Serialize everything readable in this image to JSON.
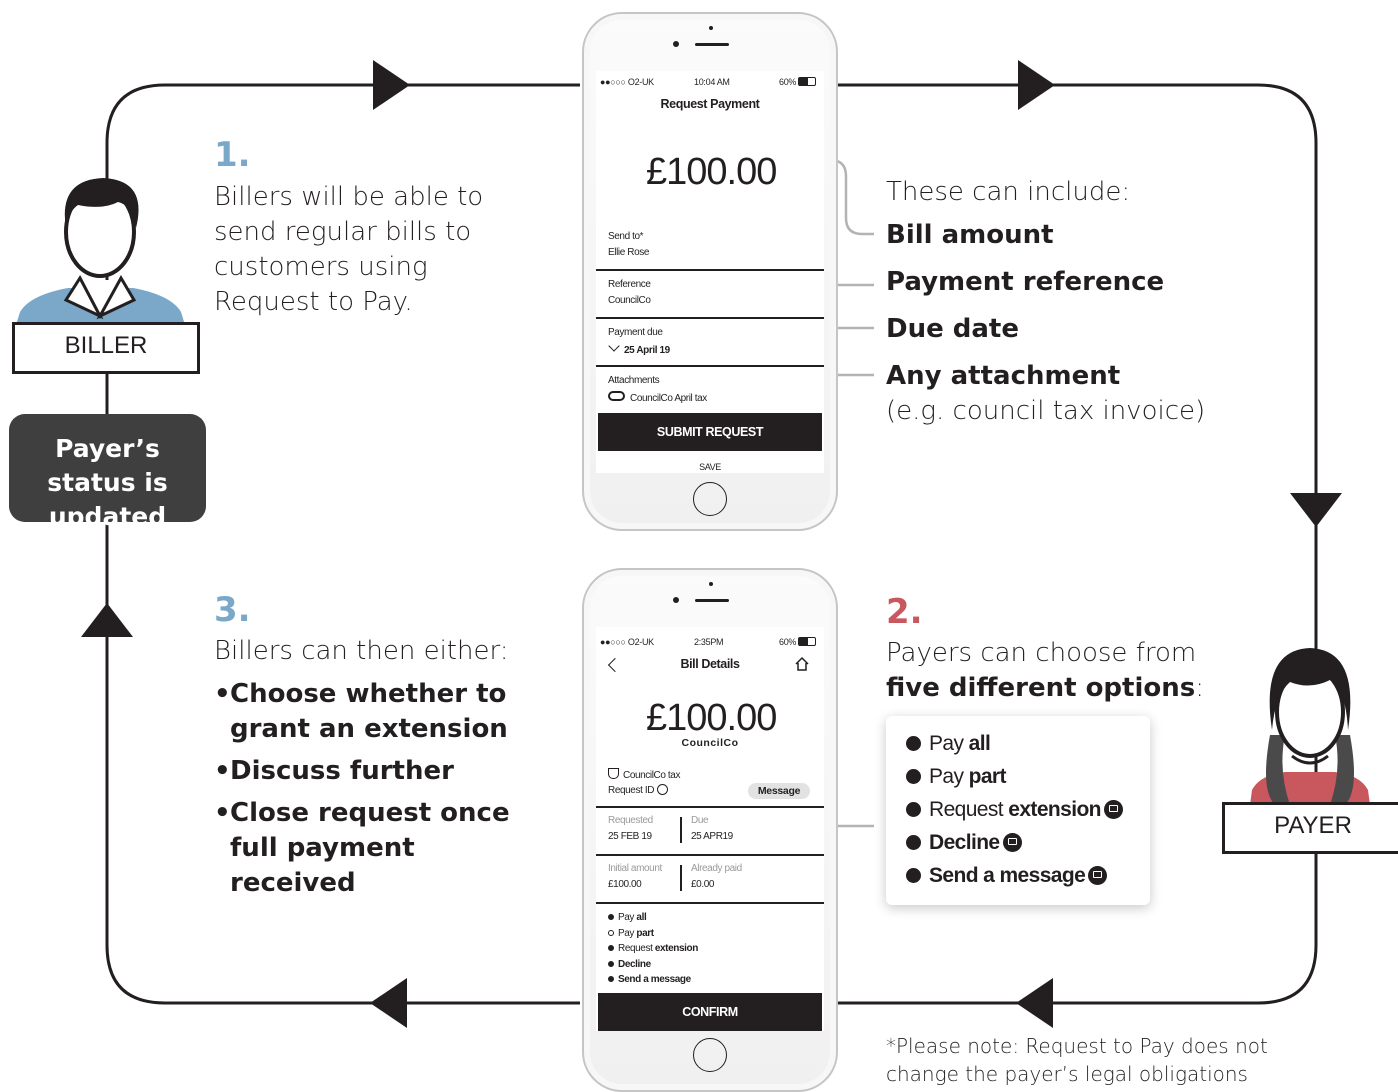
{
  "step1": {
    "number": "1.",
    "text": "Billers will be able to send regular bills to customers using Request to Pay."
  },
  "step2": {
    "number": "2.",
    "intro_plain": "Payers can choose from",
    "intro_bold": "five different options",
    "intro_end": ":"
  },
  "step3": {
    "number": "3.",
    "intro": "Billers can then either:",
    "bullets": [
      "Choose whether to grant an extension",
      "Discuss further",
      "Close request once full payment received"
    ]
  },
  "includes": {
    "heading": "These can include:",
    "items": [
      "Bill amount",
      "Payment reference",
      "Due date",
      "Any attachment"
    ],
    "note": "(e.g. council tax invoice)"
  },
  "biller_label": "BILLER",
  "payer_label": "PAYER",
  "status_label": "Payer’s status is updated",
  "footnote": "*Please note: Request to Pay does not change the payer’s legal obligations",
  "options": [
    {
      "plain": "Pay ",
      "bold": "all",
      "icon": ""
    },
    {
      "plain": "Pay ",
      "bold": "part",
      "icon": ""
    },
    {
      "plain": "Request ",
      "bold": "extension",
      "icon": "message-icon"
    },
    {
      "plain": "",
      "bold": "Decline",
      "icon": "message-icon"
    },
    {
      "plain": "",
      "bold": "Send a message",
      "icon": "message-icon"
    }
  ],
  "phone1": {
    "carrier": "●●○○○ O2-UK",
    "time": "10:04 AM",
    "battery": "60%",
    "title": "Request Payment",
    "amount": "£100.00",
    "send_to_label": "Send to*",
    "send_to_value": "Ellie Rose",
    "reference_label": "Reference",
    "reference_value": "CouncilCo",
    "due_label": "Payment due",
    "due_value": "25 April 19",
    "attachments_label": "Attachments",
    "attachments_value": "CouncilCo April tax",
    "submit": "SUBMIT REQUEST",
    "save": "SAVE"
  },
  "phone2": {
    "carrier": "●●○○○ O2-UK",
    "time": "2:35PM",
    "battery": "60%",
    "title": "Bill Details",
    "amount": "£100.00",
    "payee": "CouncilCo",
    "bill_name": "CouncilCo tax",
    "request_id": "Request ID",
    "message_btn": "Message",
    "requested_label": "Requested",
    "requested_value": "25 FEB 19",
    "due_label": "Due",
    "due_value": "25 APR19",
    "initial_label": "Initial amount",
    "initial_value": "£100.00",
    "paid_label": "Already paid",
    "paid_value": "£0.00",
    "options": [
      {
        "plain": "Pay ",
        "bold": "all"
      },
      {
        "plain": "Pay ",
        "bold": "part"
      },
      {
        "plain": "Request ",
        "bold": "extension"
      },
      {
        "plain": "",
        "bold": "Decline"
      },
      {
        "plain": "",
        "bold": "Send a message"
      }
    ],
    "confirm": "CONFIRM"
  },
  "colors": {
    "ink": "#231f20",
    "step_blue": "#7ba7c9",
    "step_red": "#c9575e",
    "biller_shirt": "#7ba7c9",
    "payer_top": "#c9575e",
    "status_bg": "#3f3f3f",
    "connector": "#b3b3b3"
  }
}
